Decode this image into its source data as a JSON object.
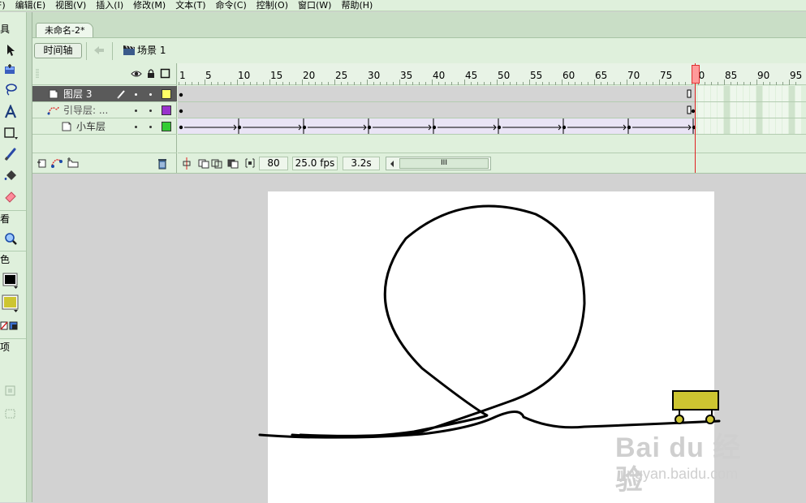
{
  "menubar": {
    "items": [
      "F)",
      "编辑(E)",
      "视图(V)",
      "插入(I)",
      "修改(M)",
      "文本(T)",
      "命令(C)",
      "控制(O)",
      "窗口(W)",
      "帮助(H)"
    ]
  },
  "tools": {
    "section_tools": "具",
    "section_view": "看",
    "section_colors": "色",
    "section_options": "项",
    "stroke_color": "#000000",
    "fill_color": "#cdc531"
  },
  "document": {
    "tab_title": "未命名-2*"
  },
  "toolbar": {
    "timeline_label": "时间轴",
    "scene_label": "场景 1"
  },
  "timeline": {
    "layers": [
      {
        "name": "图层 3",
        "color": "#ffff66",
        "selected": true
      },
      {
        "name": "引导层: ...",
        "color": "#9933cc",
        "selected": false
      },
      {
        "name": "小车层",
        "color": "#33cc33",
        "selected": false
      }
    ],
    "ruler_labels": [
      "1",
      "5",
      "10",
      "15",
      "20",
      "25",
      "30",
      "35",
      "40",
      "45",
      "50",
      "55",
      "60",
      "65",
      "70",
      "75",
      "80",
      "85",
      "90",
      "95"
    ],
    "current_frame": "80",
    "fps": "25.0 fps",
    "elapsed": "3.2s",
    "scroll_thumb_label": "III"
  },
  "stage": {
    "cart_color": "#cdc531",
    "background": "#ffffff"
  },
  "watermark": {
    "logo": "Bai du 经验",
    "url": "jingyan.baidu.com"
  }
}
